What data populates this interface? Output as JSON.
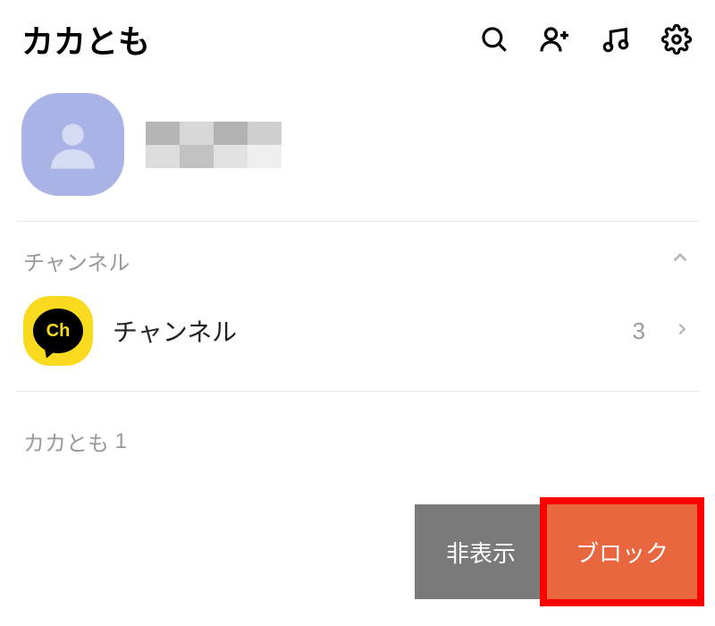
{
  "header": {
    "title": "カカとも"
  },
  "sections": {
    "channel": {
      "header": "チャンネル",
      "item_label": "チャンネル",
      "item_badge": "Ch",
      "count": "3"
    },
    "friends": {
      "header_prefix": "カカとも",
      "count": "1"
    }
  },
  "actions": {
    "hide": "非表示",
    "block": "ブロック"
  }
}
